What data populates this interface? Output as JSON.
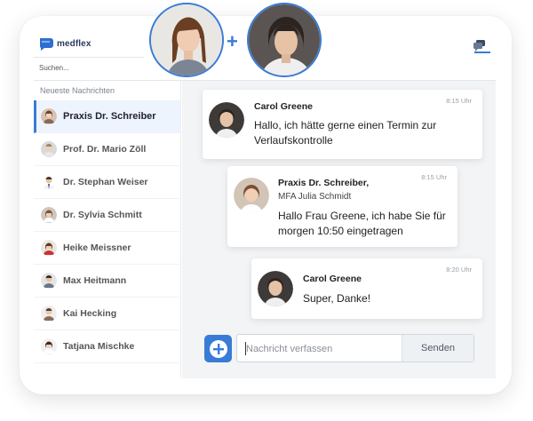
{
  "app": {
    "logo_text": "medflex"
  },
  "search": {
    "placeholder": "Suchen..."
  },
  "sidebar": {
    "title": "Neueste Nachrichten",
    "contacts": [
      {
        "name": "Praxis Dr. Schreiber",
        "active": true
      },
      {
        "name": "Prof. Dr. Mario Zöll"
      },
      {
        "name": "Dr. Stephan Weiser"
      },
      {
        "name": "Dr. Sylvia Schmitt"
      },
      {
        "name": "Heike Meissner"
      },
      {
        "name": "Max Heitmann"
      },
      {
        "name": "Kai Hecking"
      },
      {
        "name": "Tatjana Mischke"
      }
    ]
  },
  "messages": [
    {
      "sender": "Carol Greene",
      "time": "8:15 Uhr",
      "text_line1": "Hallo, ich hätte gerne einen Termin zur",
      "text_line2": "Verlaufskontrolle"
    },
    {
      "sender": "Praxis Dr. Schreiber,",
      "sub": "MFA Julia Schmidt",
      "time": "8:15 Uhr",
      "text_line1": "Hallo Frau Greene, ich habe Sie für",
      "text_line2": "morgen 10:50 eingetragen"
    },
    {
      "sender": "Carol Greene",
      "time": "8:20 Uhr",
      "text_line1": "Super, Danke!"
    }
  ],
  "composer": {
    "placeholder": "Nachricht verfassen",
    "send_label": "Senden"
  },
  "colors": {
    "accent": "#3a7bd5",
    "chat_bg": "#f3f4f6"
  },
  "icons": [
    "medflex-logo-icon",
    "chat-bubbles-icon",
    "plus-icon",
    "add-icon"
  ]
}
